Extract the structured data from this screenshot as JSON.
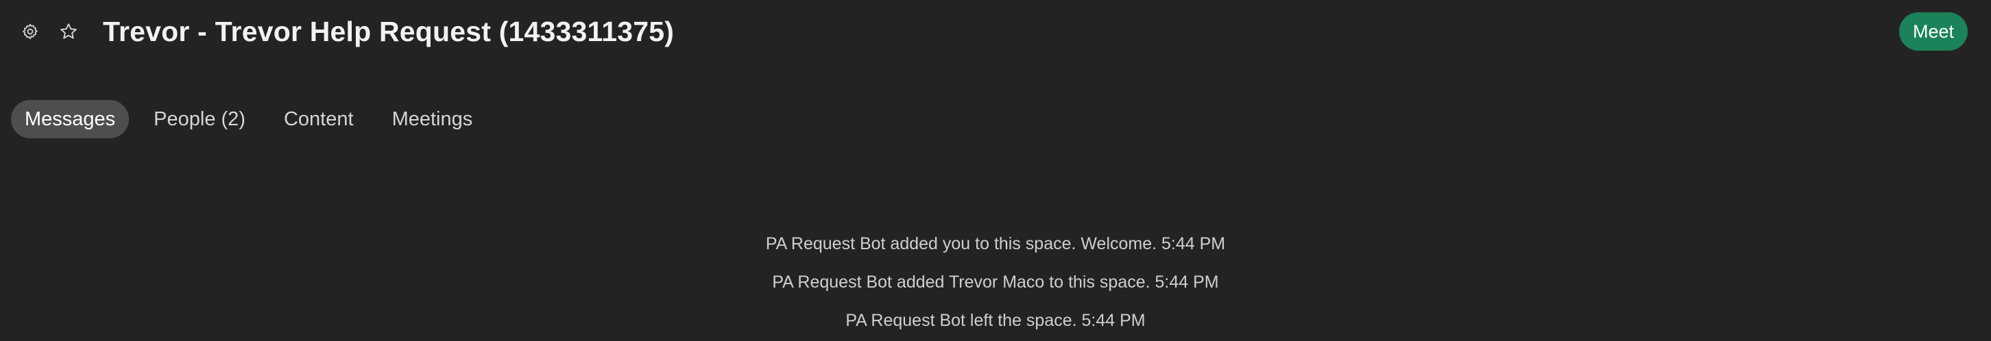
{
  "header": {
    "title": "Trevor - Trevor Help Request (1433311375)",
    "settings_icon": "gear-icon",
    "favorite_icon": "star-icon",
    "meet_label": "Meet",
    "meet_color": "#1b8259"
  },
  "tabs": [
    {
      "label": "Messages",
      "active": true
    },
    {
      "label": "People (2)",
      "active": false
    },
    {
      "label": "Content",
      "active": false
    },
    {
      "label": "Meetings",
      "active": false
    }
  ],
  "activity": [
    {
      "text": "PA Request Bot added you to this space. Welcome. 5:44 PM"
    },
    {
      "text": "PA Request Bot added Trevor Maco to this space. 5:44 PM"
    },
    {
      "text": "PA Request Bot left the space. 5:44 PM"
    }
  ],
  "colors": {
    "background": "#232323",
    "active_tab": "#4e4e4e",
    "accent": "#1b8259"
  }
}
